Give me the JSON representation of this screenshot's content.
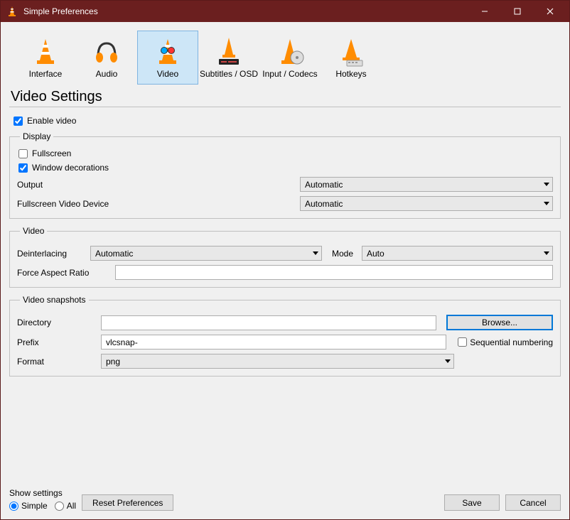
{
  "window": {
    "title": "Simple Preferences"
  },
  "tabs": [
    {
      "label": "Interface"
    },
    {
      "label": "Audio"
    },
    {
      "label": "Video"
    },
    {
      "label": "Subtitles / OSD"
    },
    {
      "label": "Input / Codecs"
    },
    {
      "label": "Hotkeys"
    }
  ],
  "page": {
    "title": "Video Settings"
  },
  "enable_video": {
    "label": "Enable video",
    "checked": true
  },
  "display_group": {
    "legend": "Display",
    "fullscreen": {
      "label": "Fullscreen",
      "checked": false
    },
    "window_decorations": {
      "label": "Window decorations",
      "checked": true
    },
    "output": {
      "label": "Output",
      "value": "Automatic"
    },
    "fullscreen_device": {
      "label": "Fullscreen Video Device",
      "value": "Automatic"
    }
  },
  "video_group": {
    "legend": "Video",
    "deinterlacing": {
      "label": "Deinterlacing",
      "value": "Automatic"
    },
    "mode": {
      "label": "Mode",
      "value": "Auto"
    },
    "force_aspect": {
      "label": "Force Aspect Ratio",
      "value": ""
    }
  },
  "snapshots_group": {
    "legend": "Video snapshots",
    "directory": {
      "label": "Directory",
      "value": "",
      "browse": "Browse..."
    },
    "prefix": {
      "label": "Prefix",
      "value": "vlcsnap-"
    },
    "sequential": {
      "label": "Sequential numbering",
      "checked": false
    },
    "format": {
      "label": "Format",
      "value": "png"
    }
  },
  "footer": {
    "show_settings_label": "Show settings",
    "simple": "Simple",
    "all": "All",
    "reset": "Reset Preferences",
    "save": "Save",
    "cancel": "Cancel"
  }
}
